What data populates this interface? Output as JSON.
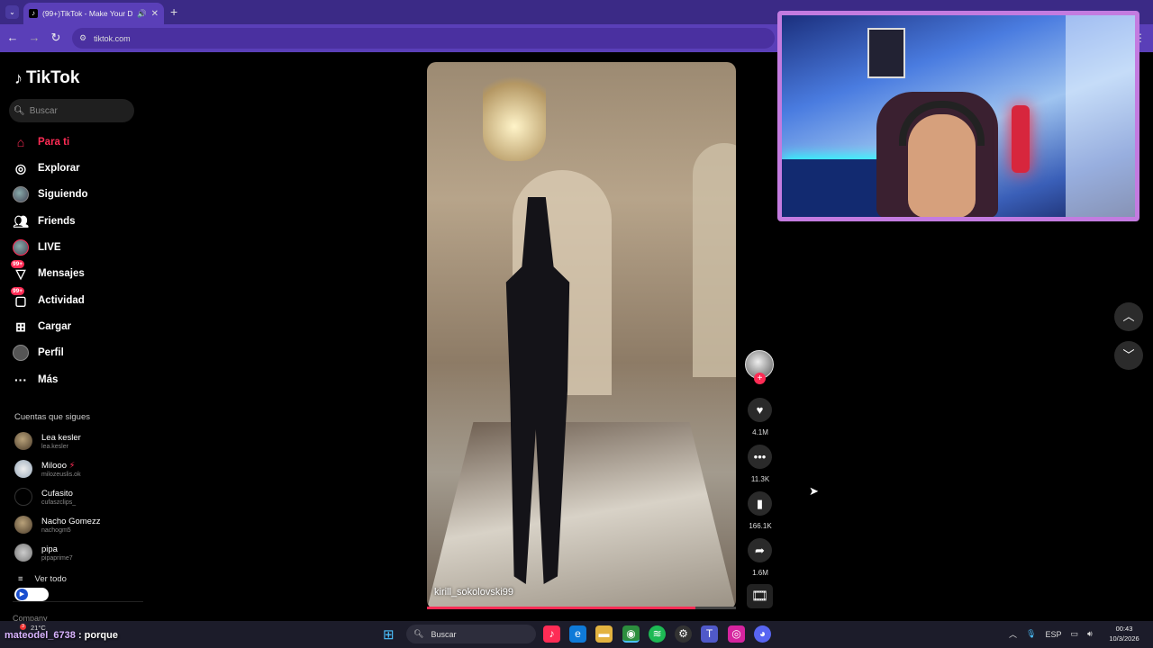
{
  "browser": {
    "tab_title": "(99+)TikTok - Make Your Da",
    "url": "tiktok.com"
  },
  "sidebar": {
    "logo_text": "TikTok",
    "search_placeholder": "Buscar",
    "nav": [
      {
        "label": "Para ti",
        "active": true
      },
      {
        "label": "Explorar"
      },
      {
        "label": "Siguiendo"
      },
      {
        "label": "Friends"
      },
      {
        "label": "LIVE"
      },
      {
        "label": "Mensajes",
        "badge": "99+"
      },
      {
        "label": "Actividad",
        "badge": "99+"
      },
      {
        "label": "Cargar"
      },
      {
        "label": "Perfil"
      },
      {
        "label": "Más"
      }
    ],
    "following_title": "Cuentas que sigues",
    "following": [
      {
        "name": "Lea kesler",
        "handle": "lea.kesler"
      },
      {
        "name": "Milooo",
        "handle": "milozeuslis.ok"
      },
      {
        "name": "Cufasito",
        "handle": "cufaszclips_"
      },
      {
        "name": "Nacho Gomezz",
        "handle": "nachogm5"
      },
      {
        "name": "pipa",
        "handle": "pipaprime7"
      }
    ],
    "see_all": "Ver todo",
    "company": "Company"
  },
  "video": {
    "username": "kirill_sokolovski99",
    "progress": 0.87
  },
  "actions": {
    "likes": "4.1M",
    "comments": "11.3K",
    "saves": "166.1K",
    "shares": "1.6M"
  },
  "chat": {
    "user": "mateodel_6738",
    "message": ": porque"
  },
  "taskbar": {
    "weather": "21°C",
    "weather_badge": "3",
    "search_placeholder": "Buscar",
    "lang": "ESP",
    "time": "00:43",
    "date": "10/3/2026"
  },
  "colors": {
    "accent": "#fe2c55",
    "browser": "#5a3fb8",
    "webcam_border": "#c37be0"
  }
}
